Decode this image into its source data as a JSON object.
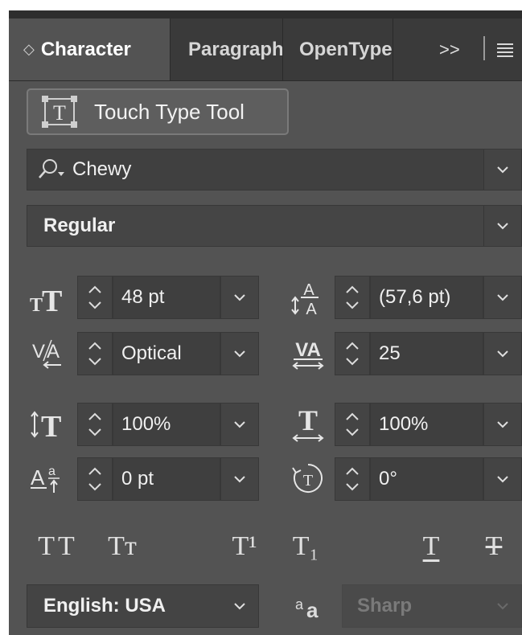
{
  "tabs": [
    {
      "label": "Character",
      "active": true
    },
    {
      "label": "Paragraph"
    },
    {
      "label": "OpenType"
    }
  ],
  "tab_overflow": ">>",
  "touch_type_label": "Touch Type Tool",
  "font_family": "Chewy",
  "font_style": "Regular",
  "fields": {
    "font_size": "48 pt",
    "leading": "(57,6 pt)",
    "kerning": "Optical",
    "tracking": "25",
    "vertical_scale": "100%",
    "horizontal_scale": "100%",
    "baseline_shift": "0 pt",
    "rotation": "0°"
  },
  "type_buttons": [
    {
      "name": "all-caps",
      "glyph": "TT"
    },
    {
      "name": "small-caps",
      "glyph": "Tт"
    },
    {
      "name": "superscript",
      "glyph": "T¹"
    },
    {
      "name": "subscript",
      "glyph": "T₁"
    },
    {
      "name": "underline",
      "glyph": "T"
    },
    {
      "name": "strikethrough",
      "glyph": "T"
    }
  ],
  "language": "English: USA",
  "antialias_icon_text": "aa",
  "antialias": "Sharp",
  "colors": {
    "panel_bg": "#535353",
    "tabbar_bg": "#3a3a3a",
    "field_bg": "#404040",
    "text": "#f0f0f0"
  }
}
